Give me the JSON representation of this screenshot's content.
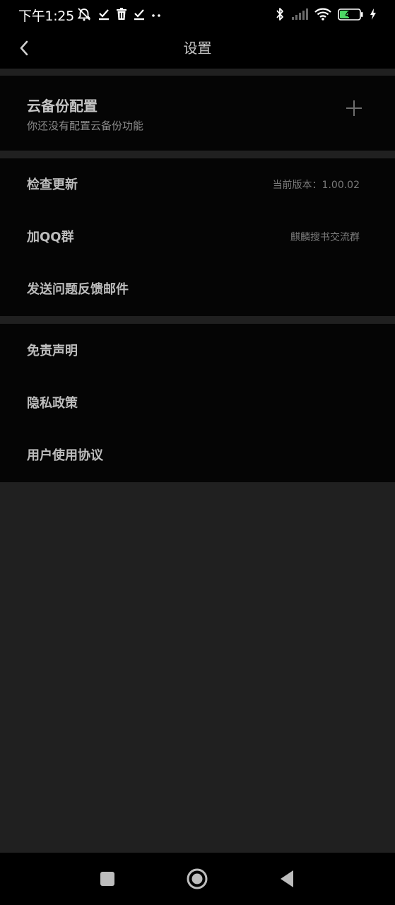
{
  "status_bar": {
    "time": "下午1:25",
    "left_icons": [
      "alarm-off-icon",
      "check-download-icon",
      "trash-icon",
      "check-download-icon",
      "more-dots-icon"
    ],
    "right_icons": [
      "bluetooth-icon",
      "signal-icon",
      "wifi-icon",
      "battery-icon",
      "charging-icon"
    ],
    "battery_level": "41"
  },
  "app_bar": {
    "back_icon": "chevron-left-icon",
    "title": "设置"
  },
  "cloud_backup": {
    "title": "云备份配置",
    "subtitle": "你还没有配置云备份功能",
    "add_icon": "plus-icon"
  },
  "settings": {
    "check_update": {
      "label": "检查更新",
      "value": "当前版本：1.00.02"
    },
    "join_qq": {
      "label": "加QQ群",
      "value": "麒麟搜书交流群"
    },
    "feedback": {
      "label": "发送问题反馈邮件"
    }
  },
  "legal": {
    "disclaimer": "免责声明",
    "privacy": "隐私政策",
    "agreement": "用户使用协议"
  },
  "nav_bar": {
    "icons": [
      "recents-square-icon",
      "home-circle-icon",
      "back-triangle-icon"
    ]
  },
  "colors": {
    "page_background": "#202020",
    "card_background": "#050505",
    "bars": "#000000",
    "label_text": "#bdbdbd",
    "secondary_text": "#7a7a7a"
  }
}
